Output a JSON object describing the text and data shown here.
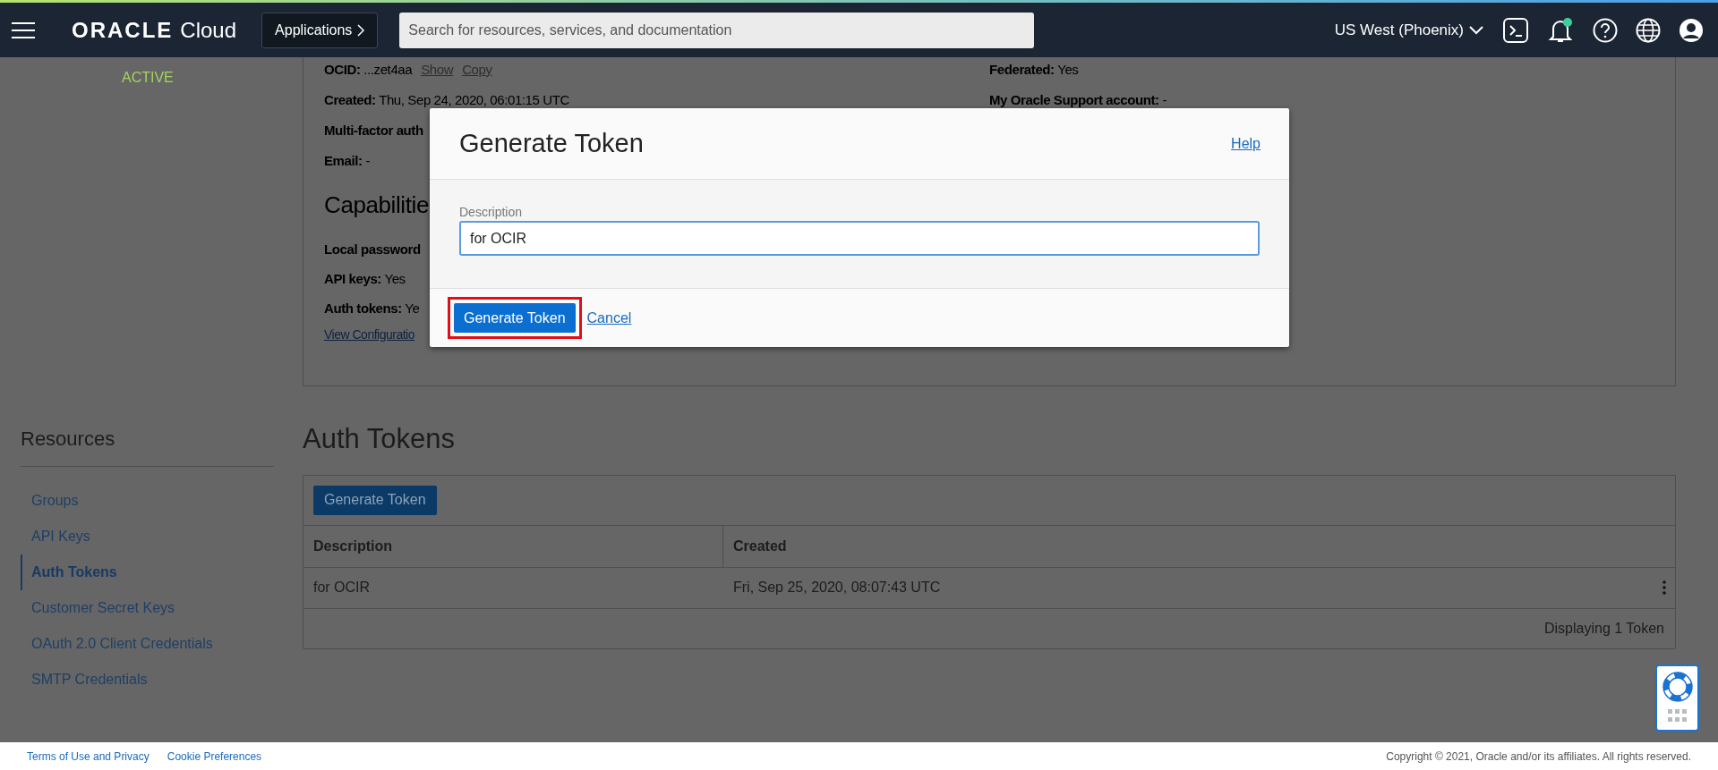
{
  "header": {
    "brand": "ORACLE",
    "product": "Cloud",
    "apps_button": "Applications",
    "search": {
      "placeholder": "Search for resources, services, and documentation"
    },
    "region": "US West (Phoenix)",
    "notification_dot": true
  },
  "user_status": "ACTIVE",
  "details": {
    "left": [
      {
        "text": "**OCID:** ...zet4aa",
        "links": [
          "Show",
          "Copy"
        ]
      },
      {
        "text": "**Created:** Thu, Sep 24, 2020, 06:01:15 UTC"
      },
      {
        "text": "**Multi-factor auth**"
      },
      {
        "text": "**Email:** -"
      }
    ],
    "right": [
      {
        "text": "**Federated:** Yes"
      },
      {
        "text": "**My Oracle Support account:** -"
      }
    ],
    "capabilities_title": "Capabilitie",
    "capabilities": [
      {
        "text": "**Local password**"
      },
      {
        "text": "**API keys:** Yes"
      },
      {
        "text": "**Auth tokens:** Ye"
      }
    ],
    "view_link": "View Configuratio"
  },
  "resources": {
    "title": "Resources",
    "items": [
      {
        "label": "Groups",
        "selected": false
      },
      {
        "label": "API Keys",
        "selected": false
      },
      {
        "label": "Auth Tokens",
        "selected": true
      },
      {
        "label": "Customer Secret Keys",
        "selected": false
      },
      {
        "label": "OAuth 2.0 Client Credentials",
        "selected": false
      },
      {
        "label": "SMTP Credentials",
        "selected": false
      }
    ]
  },
  "auth_tokens": {
    "title": "Auth Tokens",
    "button": "Generate Token",
    "columns": [
      "Description",
      "Created"
    ],
    "rows": [
      [
        "for OCIR",
        "Fri, Sep 25, 2020, 08:07:43 UTC"
      ]
    ],
    "footer": "Displaying 1 Token"
  },
  "dialog": {
    "title": "Generate Token",
    "help": "Help",
    "field_label": "Description",
    "field_value": "for OCIR",
    "primary_button": "Generate Token",
    "primary_highlighted": true,
    "cancel": "Cancel"
  },
  "footer": {
    "links": [
      "Terms of Use and Privacy",
      "Cookie Preferences"
    ],
    "copyright": "Copyright © 2021, Oracle and/or its affiliates. All rights reserved."
  }
}
